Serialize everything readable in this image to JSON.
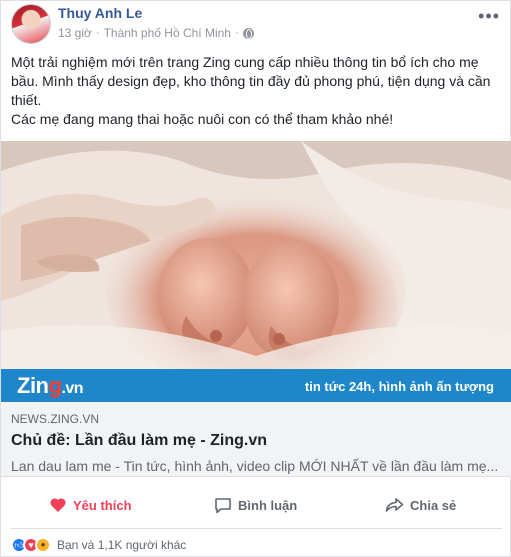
{
  "post": {
    "author": "Thuy Anh Le",
    "time": "13 giờ",
    "location": "Thành phố Hồ Chí Minh",
    "more_icon": "more-icon",
    "text_lines": [
      "Một trải nghiệm mới trên trang Zing cung cấp nhiều thông tin bổ ích cho mẹ",
      "bầu. Mình thấy design đẹp, kho thông tin đầy đủ phong phú, tiện dụng và cần",
      "thiết.",
      "Các mẹ đang mang thai hoặc nuôi con có thể tham khảo nhé!"
    ]
  },
  "banner": {
    "logo_main": "Zin",
    "logo_g": "g",
    "logo_suffix": ".vn",
    "tagline": "tin tức 24h, hình ảnh ấn tượng"
  },
  "link": {
    "domain": "NEWS.ZING.VN",
    "title": "Chủ đề: Lần đầu làm mẹ - Zing.vn",
    "description": "Lan dau lam me - Tin tức, hình ảnh, video clip MỚI NHẤT về lần đầu làm mẹ..."
  },
  "actions": {
    "like": "Yêu thích",
    "comment": "Bình luận",
    "share": "Chia sẻ"
  },
  "reactions": {
    "summary": "Bạn và 1,1K người khác",
    "types": [
      "like-icon",
      "love-icon",
      "wow-icon"
    ]
  },
  "colors": {
    "link_blue": "#365899",
    "zing_blue": "#1e87c9",
    "love_red": "#f33e58",
    "like_blue": "#1877f2",
    "wow_yellow": "#f7b125"
  }
}
